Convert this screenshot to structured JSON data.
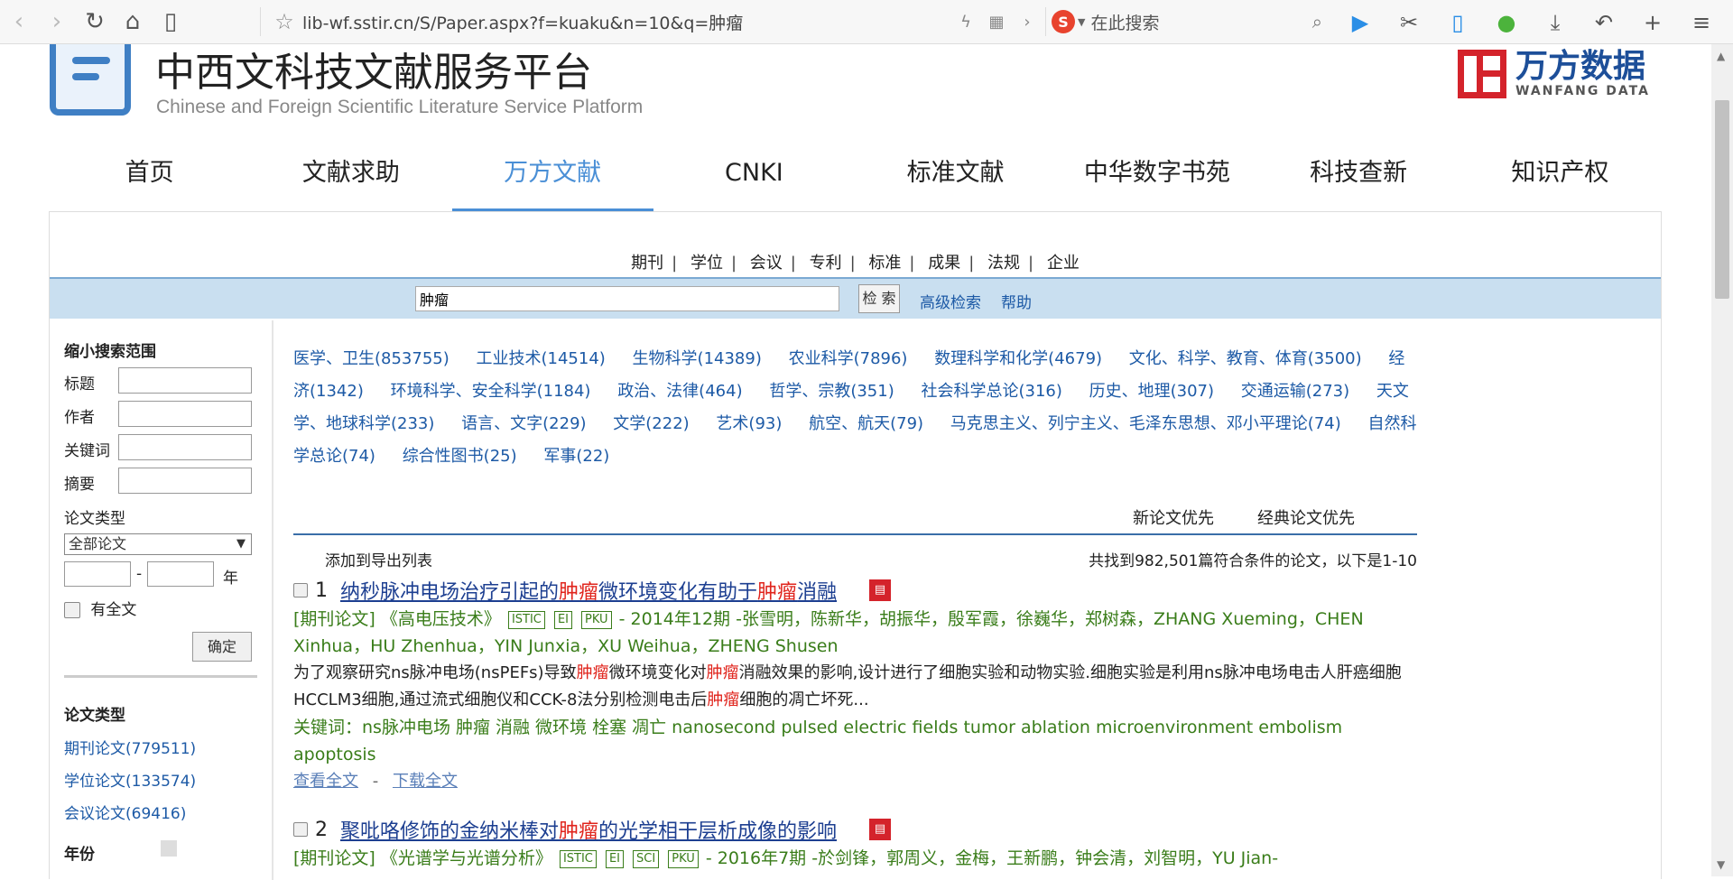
{
  "browser": {
    "url": "lib-wf.sstir.cn/S/Paper.aspx?f=kuaku&n=10&q=肿瘤",
    "search_placeholder": "在此搜索"
  },
  "header": {
    "title": "中西文科技文献服务平台",
    "subtitle": "Chinese and Foreign Scientific Literature Service Platform",
    "brand_cn": "万方数据",
    "brand_en": "WANFANG DATA"
  },
  "main_nav": [
    "首页",
    "文献求助",
    "万方文献",
    "CNKI",
    "标准文献",
    "中华数字书苑",
    "科技查新",
    "知识产权"
  ],
  "sub_nav": [
    "期刊",
    "学位",
    "会议",
    "专利",
    "标准",
    "成果",
    "法规",
    "企业"
  ],
  "search": {
    "value": "肿瘤",
    "button": "检 索",
    "advanced": "高级检索",
    "help": "帮助"
  },
  "sidebar": {
    "title": "缩小搜索范围",
    "fields": [
      "标题",
      "作者",
      "关键词",
      "摘要"
    ],
    "paper_type_label": "论文类型",
    "paper_type_selected": "全部论文",
    "year_sep": "-",
    "year_unit": "年",
    "fulltext_label": "有全文",
    "ok_button": "确定",
    "type_section_title": "论文类型",
    "type_links": [
      "期刊论文(779511)",
      "学位论文(133574)",
      "会议论文(69416)"
    ],
    "year_section_title": "年份"
  },
  "categories": [
    "医学、卫生(853755)",
    "工业技术(14514)",
    "生物科学(14389)",
    "农业科学(7896)",
    "数理科学和化学(4679)",
    "文化、科学、教育、体育(3500)",
    "经济(1342)",
    "环境科学、安全科学(1184)",
    "政治、法律(464)",
    "哲学、宗教(351)",
    "社会科学总论(316)",
    "历史、地理(307)",
    "交通运输(273)",
    "天文学、地球科学(233)",
    "语言、文字(229)",
    "文学(222)",
    "艺术(93)",
    "航空、航天(79)",
    "马克思主义、列宁主义、毛泽东思想、邓小平理论(74)",
    "自然科学总论(74)",
    "综合性图书(25)",
    "军事(22)"
  ],
  "sort": {
    "new_first": "新论文优先",
    "classic_first": "经典论文优先"
  },
  "results_header": {
    "add_export": "添加到导出列表",
    "found": "共找到982,501篇符合条件的论文，以下是1-10"
  },
  "results": [
    {
      "num": "1",
      "title_parts": [
        "纳秒脉冲电场治疗引起的",
        "肿瘤",
        "微环境变化有助于",
        "肿瘤",
        "消融"
      ],
      "type": "[期刊论文]",
      "journal": "《高电压技术》",
      "badges": [
        "ISTIC",
        "EI",
        "PKU"
      ],
      "issue": "- 2014年12期",
      "authors": "-张雪明，陈新华，胡振华，殷军霞，徐巍华，郑树森，ZHANG Xueming，CHEN Xinhua，HU Zhenhua，YIN Junxia，XU Weihua，ZHENG Shusen",
      "abstract_parts": [
        "为了观察研究ns脉冲电场(nsPEFs)导致",
        "肿瘤",
        "微环境变化对",
        "肿瘤",
        "消融效果的影响,设计进行了细胞实验和动物实验.细胞实验是利用ns脉冲电场电击人肝癌细胞HCCLM3细胞,通过流式细胞仪和CCK-8法分别检测电击后",
        "肿瘤",
        "细胞的凋亡坏死..."
      ],
      "keywords": "关键词：ns脉冲电场 肿瘤 消融 微环境 栓塞 凋亡 nanosecond pulsed electric fields tumor ablation microenvironment embolism apoptosis",
      "view": "查看全文",
      "link_sep": "-",
      "download": "下载全文"
    },
    {
      "num": "2",
      "title_parts": [
        "聚吡咯修饰的金纳米棒对",
        "肿瘤",
        "的光学相干层析成像的影响"
      ],
      "type": "[期刊论文]",
      "journal": "《光谱学与光谱分析》",
      "badges": [
        "ISTIC",
        "EI",
        "SCI",
        "PKU"
      ],
      "issue": "- 2016年7期",
      "authors": "-於剑锋，郭周义，金梅，王新鹏，钟会清，刘智明，YU Jian-"
    }
  ]
}
